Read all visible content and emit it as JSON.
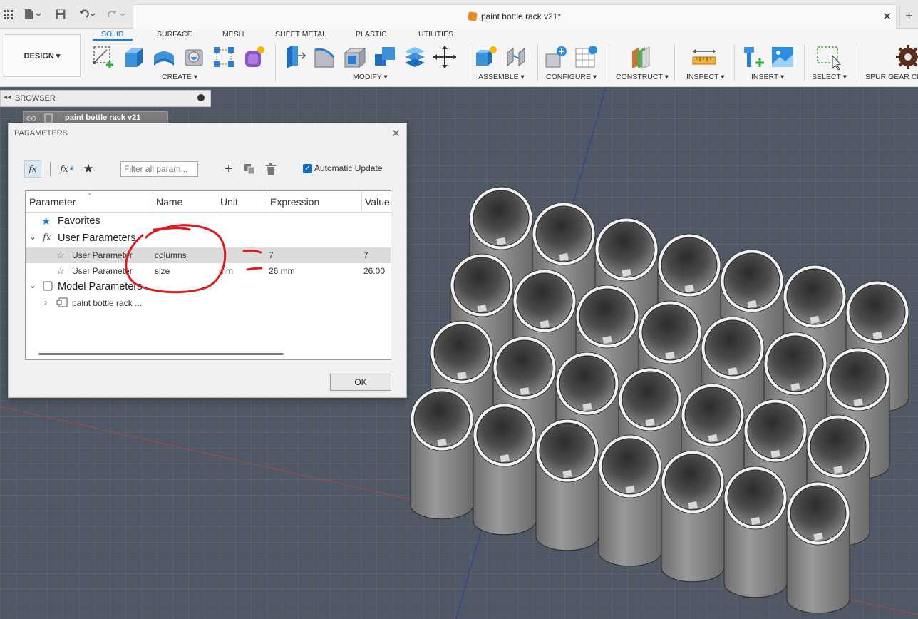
{
  "window": {
    "doc_title": "paint bottle rack v21*",
    "close_glyph": "✕",
    "new_tab_glyph": "+"
  },
  "toolbar": {
    "workspace": "DESIGN ▾",
    "tabs": [
      "SOLID",
      "SURFACE",
      "MESH",
      "SHEET METAL",
      "PLASTIC",
      "UTILITIES"
    ],
    "groups": {
      "create": "CREATE ▾",
      "modify": "MODIFY ▾",
      "assemble": "ASSEMBLE ▾",
      "configure": "CONFIGURE ▾",
      "construct": "CONSTRUCT ▾",
      "inspect": "INSPECT ▾",
      "insert": "INSERT ▾",
      "select": "SELECT ▾",
      "spur_gear": "SPUR GEAR CR"
    }
  },
  "browser": {
    "title": "BROWSER",
    "root_node": "paint bottle rack v21"
  },
  "dialog": {
    "title": "PARAMETERS",
    "filter_placeholder": "Filter all param...",
    "auto_update_label": "Automatic Update",
    "ok_label": "OK",
    "columns": [
      "Parameter",
      "Name",
      "Unit",
      "Expression",
      "Value"
    ],
    "sections": {
      "favorites": "Favorites",
      "user_parameters": "User Parameters",
      "model_parameters": "Model Parameters"
    },
    "user_params": [
      {
        "parameter": "User Parameter",
        "name": "columns",
        "unit": "",
        "expression": "7",
        "value": "7"
      },
      {
        "parameter": "User Parameter",
        "name": "size",
        "unit": "mm",
        "expression": "26 mm",
        "value": "26.00"
      }
    ],
    "model_node": "paint bottle rack ..."
  },
  "colors": {
    "accent": "#1a7fd4",
    "annotation": "#e0191e",
    "viewport_bg": "#4f5864",
    "part_grey": "#7d7d7d"
  }
}
